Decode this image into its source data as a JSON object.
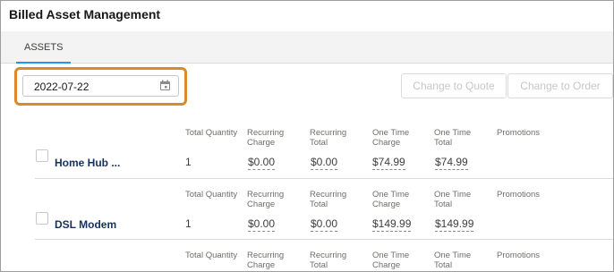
{
  "app": {
    "title": "Billed Asset Management"
  },
  "tabs": [
    {
      "label": "ASSETS",
      "active": true
    }
  ],
  "filters": {
    "date_value": "2022-07-22"
  },
  "toolbar": {
    "change_to_quote_label": "Change to Quote",
    "change_to_order_label": "Change to Order"
  },
  "columns": {
    "total_quantity": "Total Quantity",
    "recurring_charge": "Recurring Charge",
    "recurring_total": "Recurring Total",
    "one_time_charge": "One Time Charge",
    "one_time_total": "One Time Total",
    "promotions": "Promotions"
  },
  "assets": [
    {
      "name": "Home Hub ...",
      "total_quantity": "1",
      "recurring_charge": "$0.00",
      "recurring_total": "$0.00",
      "one_time_charge": "$74.99",
      "one_time_total": "$74.99"
    },
    {
      "name": "DSL Modem",
      "total_quantity": "1",
      "recurring_charge": "$0.00",
      "recurring_total": "$0.00",
      "one_time_charge": "$149.99",
      "one_time_total": "$149.99"
    },
    {
      "name": ""
    }
  ],
  "colors": {
    "accent_tab": "#1b96ff",
    "focus_outline": "#d98a2b",
    "asset_link": "#16325c"
  }
}
